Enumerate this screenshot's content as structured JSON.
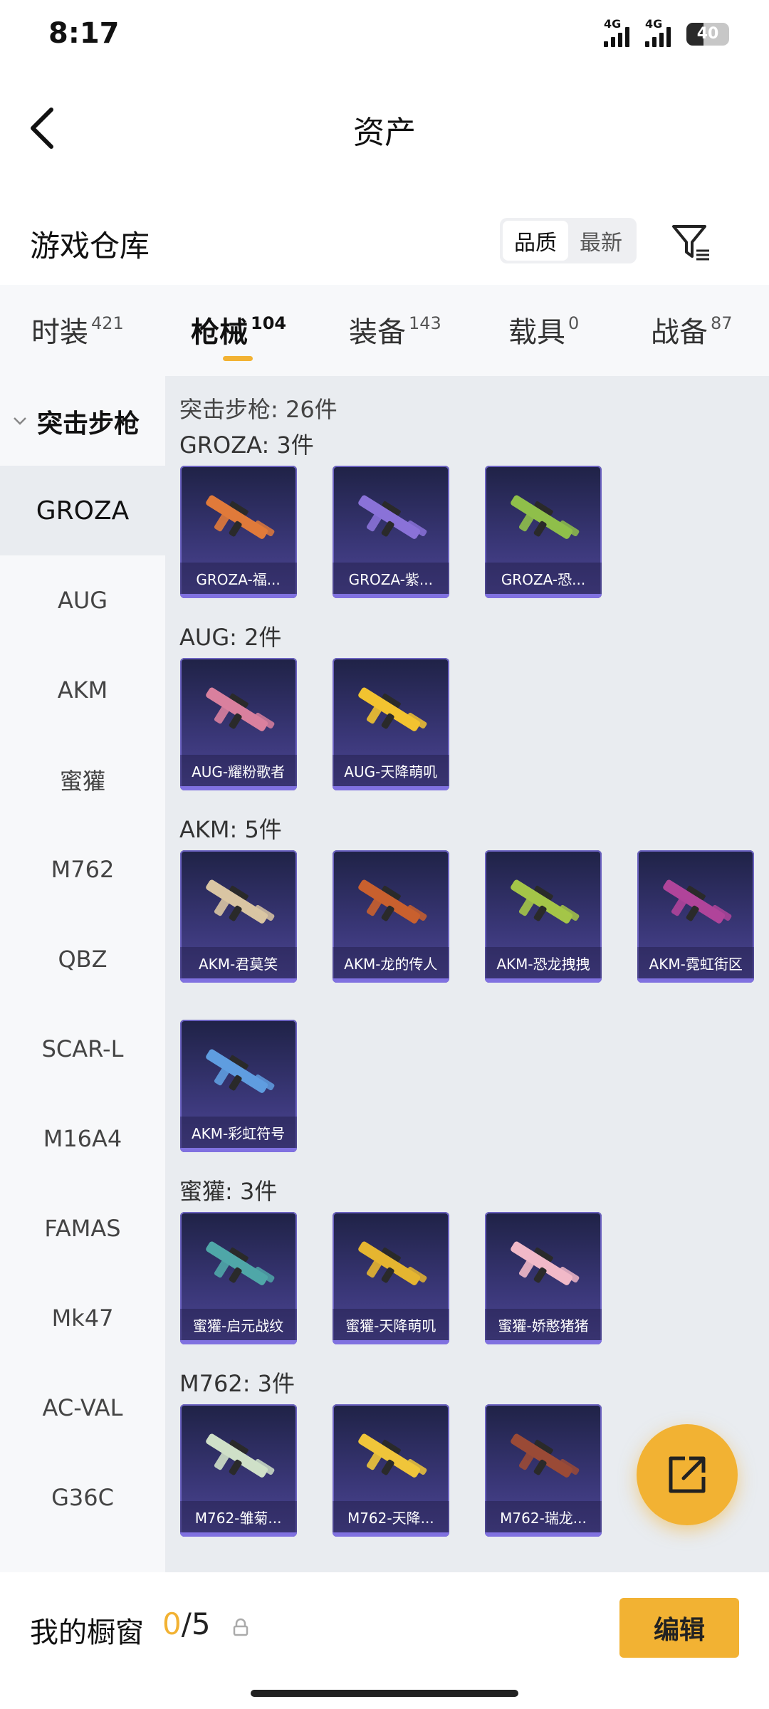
{
  "status_bar": {
    "time": "8:17",
    "network_1": "4G",
    "network_2": "4G",
    "battery": "40",
    "battery_level": 0.4
  },
  "header": {
    "title": "资产"
  },
  "warehouse": {
    "title": "游戏仓库",
    "sort_quality": "品质",
    "sort_newest": "最新"
  },
  "tabs": [
    {
      "label": "时装",
      "count": "421"
    },
    {
      "label": "枪械",
      "count": "104",
      "active": true
    },
    {
      "label": "装备",
      "count": "143"
    },
    {
      "label": "载具",
      "count": "0"
    },
    {
      "label": "战备",
      "count": "87"
    }
  ],
  "sidebar": {
    "category": "突击步枪",
    "items": [
      "GROZA",
      "AUG",
      "AKM",
      "蜜獾",
      "M762",
      "QBZ",
      "SCAR-L",
      "M16A4",
      "FAMAS",
      "Mk47",
      "AC-VAL",
      "G36C"
    ],
    "active_index": 0
  },
  "content": {
    "total": "突击步枪: 26件",
    "groups": [
      {
        "label": "GROZA: 3件",
        "items": [
          {
            "name": "GROZA-福...",
            "color": "#e07a3a"
          },
          {
            "name": "GROZA-紫...",
            "color": "#8a72d8"
          },
          {
            "name": "GROZA-恐...",
            "color": "#8fbf4a"
          }
        ]
      },
      {
        "label": "AUG: 2件",
        "items": [
          {
            "name": "AUG-耀粉歌者",
            "color": "#d9809e"
          },
          {
            "name": "AUG-天降萌叽",
            "color": "#f2c330"
          }
        ]
      },
      {
        "label": "AKM: 5件",
        "items": [
          {
            "name": "AKM-君莫笑",
            "color": "#d9c5a3"
          },
          {
            "name": "AKM-龙的传人",
            "color": "#c9602e"
          },
          {
            "name": "AKM-恐龙拽拽",
            "color": "#a4c548"
          },
          {
            "name": "AKM-霓虹街区",
            "color": "#b0449a"
          },
          {
            "name": "AKM-彩虹符号",
            "color": "#5f9de0"
          }
        ]
      },
      {
        "label": "蜜獾: 3件",
        "items": [
          {
            "name": "蜜獾-启元战纹",
            "color": "#4fa7a8"
          },
          {
            "name": "蜜獾-天降萌叽",
            "color": "#e5b530"
          },
          {
            "name": "蜜獾-娇憨猪猪",
            "color": "#f1b9c8"
          }
        ]
      },
      {
        "label": "M762: 3件",
        "items": [
          {
            "name": "M762-雏菊...",
            "color": "#cfe0c8"
          },
          {
            "name": "M762-天降...",
            "color": "#f0c53a"
          },
          {
            "name": "M762-瑞龙...",
            "color": "#9a4a36"
          }
        ]
      }
    ]
  },
  "bottom_bar": {
    "label": "我的橱窗",
    "current": "0",
    "separator": "/",
    "max": "5",
    "edit_label": "编辑"
  },
  "colors": {
    "accent": "#f2b233",
    "card_top": "#1f2246",
    "card_bottom": "#4e4795"
  }
}
